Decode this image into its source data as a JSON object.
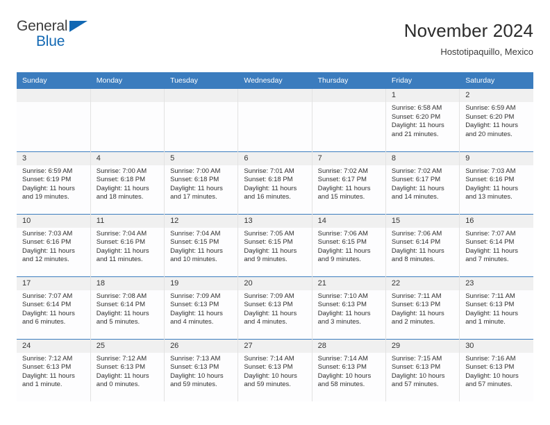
{
  "logo": {
    "word1": "General",
    "word2": "Blue",
    "triangle_color": "#1268b3"
  },
  "header": {
    "title": "November 2024",
    "subtitle": "Hostotipaquillo, Mexico"
  },
  "theme": {
    "header_blue": "#3b7cbe",
    "daynum_gray": "#f0f0f0",
    "cell_white": "#fdfdfe",
    "grid_line": "#e2e2e2"
  },
  "weekday_headers": [
    "Sunday",
    "Monday",
    "Tuesday",
    "Wednesday",
    "Thursday",
    "Friday",
    "Saturday"
  ],
  "labels": {
    "sunrise_prefix": "Sunrise:",
    "sunset_prefix": "Sunset:",
    "daylight_prefix": "Daylight:"
  },
  "weeks": [
    [
      {
        "day": "",
        "sunrise": "",
        "sunset": "",
        "daylight": ""
      },
      {
        "day": "",
        "sunrise": "",
        "sunset": "",
        "daylight": ""
      },
      {
        "day": "",
        "sunrise": "",
        "sunset": "",
        "daylight": ""
      },
      {
        "day": "",
        "sunrise": "",
        "sunset": "",
        "daylight": ""
      },
      {
        "day": "",
        "sunrise": "",
        "sunset": "",
        "daylight": ""
      },
      {
        "day": "1",
        "sunrise": "Sunrise: 6:58 AM",
        "sunset": "Sunset: 6:20 PM",
        "daylight": "Daylight: 11 hours and 21 minutes."
      },
      {
        "day": "2",
        "sunrise": "Sunrise: 6:59 AM",
        "sunset": "Sunset: 6:20 PM",
        "daylight": "Daylight: 11 hours and 20 minutes."
      }
    ],
    [
      {
        "day": "3",
        "sunrise": "Sunrise: 6:59 AM",
        "sunset": "Sunset: 6:19 PM",
        "daylight": "Daylight: 11 hours and 19 minutes."
      },
      {
        "day": "4",
        "sunrise": "Sunrise: 7:00 AM",
        "sunset": "Sunset: 6:18 PM",
        "daylight": "Daylight: 11 hours and 18 minutes."
      },
      {
        "day": "5",
        "sunrise": "Sunrise: 7:00 AM",
        "sunset": "Sunset: 6:18 PM",
        "daylight": "Daylight: 11 hours and 17 minutes."
      },
      {
        "day": "6",
        "sunrise": "Sunrise: 7:01 AM",
        "sunset": "Sunset: 6:18 PM",
        "daylight": "Daylight: 11 hours and 16 minutes."
      },
      {
        "day": "7",
        "sunrise": "Sunrise: 7:02 AM",
        "sunset": "Sunset: 6:17 PM",
        "daylight": "Daylight: 11 hours and 15 minutes."
      },
      {
        "day": "8",
        "sunrise": "Sunrise: 7:02 AM",
        "sunset": "Sunset: 6:17 PM",
        "daylight": "Daylight: 11 hours and 14 minutes."
      },
      {
        "day": "9",
        "sunrise": "Sunrise: 7:03 AM",
        "sunset": "Sunset: 6:16 PM",
        "daylight": "Daylight: 11 hours and 13 minutes."
      }
    ],
    [
      {
        "day": "10",
        "sunrise": "Sunrise: 7:03 AM",
        "sunset": "Sunset: 6:16 PM",
        "daylight": "Daylight: 11 hours and 12 minutes."
      },
      {
        "day": "11",
        "sunrise": "Sunrise: 7:04 AM",
        "sunset": "Sunset: 6:16 PM",
        "daylight": "Daylight: 11 hours and 11 minutes."
      },
      {
        "day": "12",
        "sunrise": "Sunrise: 7:04 AM",
        "sunset": "Sunset: 6:15 PM",
        "daylight": "Daylight: 11 hours and 10 minutes."
      },
      {
        "day": "13",
        "sunrise": "Sunrise: 7:05 AM",
        "sunset": "Sunset: 6:15 PM",
        "daylight": "Daylight: 11 hours and 9 minutes."
      },
      {
        "day": "14",
        "sunrise": "Sunrise: 7:06 AM",
        "sunset": "Sunset: 6:15 PM",
        "daylight": "Daylight: 11 hours and 9 minutes."
      },
      {
        "day": "15",
        "sunrise": "Sunrise: 7:06 AM",
        "sunset": "Sunset: 6:14 PM",
        "daylight": "Daylight: 11 hours and 8 minutes."
      },
      {
        "day": "16",
        "sunrise": "Sunrise: 7:07 AM",
        "sunset": "Sunset: 6:14 PM",
        "daylight": "Daylight: 11 hours and 7 minutes."
      }
    ],
    [
      {
        "day": "17",
        "sunrise": "Sunrise: 7:07 AM",
        "sunset": "Sunset: 6:14 PM",
        "daylight": "Daylight: 11 hours and 6 minutes."
      },
      {
        "day": "18",
        "sunrise": "Sunrise: 7:08 AM",
        "sunset": "Sunset: 6:14 PM",
        "daylight": "Daylight: 11 hours and 5 minutes."
      },
      {
        "day": "19",
        "sunrise": "Sunrise: 7:09 AM",
        "sunset": "Sunset: 6:13 PM",
        "daylight": "Daylight: 11 hours and 4 minutes."
      },
      {
        "day": "20",
        "sunrise": "Sunrise: 7:09 AM",
        "sunset": "Sunset: 6:13 PM",
        "daylight": "Daylight: 11 hours and 4 minutes."
      },
      {
        "day": "21",
        "sunrise": "Sunrise: 7:10 AM",
        "sunset": "Sunset: 6:13 PM",
        "daylight": "Daylight: 11 hours and 3 minutes."
      },
      {
        "day": "22",
        "sunrise": "Sunrise: 7:11 AM",
        "sunset": "Sunset: 6:13 PM",
        "daylight": "Daylight: 11 hours and 2 minutes."
      },
      {
        "day": "23",
        "sunrise": "Sunrise: 7:11 AM",
        "sunset": "Sunset: 6:13 PM",
        "daylight": "Daylight: 11 hours and 1 minute."
      }
    ],
    [
      {
        "day": "24",
        "sunrise": "Sunrise: 7:12 AM",
        "sunset": "Sunset: 6:13 PM",
        "daylight": "Daylight: 11 hours and 1 minute."
      },
      {
        "day": "25",
        "sunrise": "Sunrise: 7:12 AM",
        "sunset": "Sunset: 6:13 PM",
        "daylight": "Daylight: 11 hours and 0 minutes."
      },
      {
        "day": "26",
        "sunrise": "Sunrise: 7:13 AM",
        "sunset": "Sunset: 6:13 PM",
        "daylight": "Daylight: 10 hours and 59 minutes."
      },
      {
        "day": "27",
        "sunrise": "Sunrise: 7:14 AM",
        "sunset": "Sunset: 6:13 PM",
        "daylight": "Daylight: 10 hours and 59 minutes."
      },
      {
        "day": "28",
        "sunrise": "Sunrise: 7:14 AM",
        "sunset": "Sunset: 6:13 PM",
        "daylight": "Daylight: 10 hours and 58 minutes."
      },
      {
        "day": "29",
        "sunrise": "Sunrise: 7:15 AM",
        "sunset": "Sunset: 6:13 PM",
        "daylight": "Daylight: 10 hours and 57 minutes."
      },
      {
        "day": "30",
        "sunrise": "Sunrise: 7:16 AM",
        "sunset": "Sunset: 6:13 PM",
        "daylight": "Daylight: 10 hours and 57 minutes."
      }
    ]
  ]
}
